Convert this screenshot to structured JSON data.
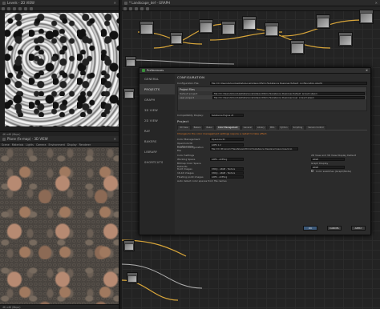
{
  "left_top_panel": {
    "title": "Levels - 2D VIEW",
    "status": "4K x4K (8bpc)"
  },
  "left_bottom_panel": {
    "title": "Plane (fx-map) - 3D VIEW",
    "menu": [
      "Scene",
      "Materials",
      "Lights",
      "Camera",
      "Environment",
      "Display",
      "Renderer"
    ],
    "status": "4K x4K (8bpc)"
  },
  "graph_panel": {
    "title": "* Landscape_def - GRAPH"
  },
  "dialog": {
    "title": "Preferences",
    "nav": [
      "GENERAL",
      "PROJECTS",
      "GRAPH",
      "3D VIEW",
      "2D VIEW",
      "RAY",
      "BAKERS",
      "LIBRARY",
      "SHORTCUTS"
    ],
    "active_nav": "PROJECTS",
    "config_heading": "CONFIGURATION",
    "config_file_label": "Configuration File:",
    "config_file_value": "file:///C:/Users/lutug/AppData/Local/Allegorithmic/Substance Designer/default_configuration.sbscfg",
    "project_files_heading": "Project Files",
    "default_project_label": "Default project",
    "default_project_value": "file:///C:/Users/lutug/AppData/Local/Allegorithmic/Substance Designer/default_project.sbsprj",
    "user_project_label": "user project",
    "user_project_value": "file:///C:/Users/lutug/AppData/Local/Allegorithmic/Substance Designer/user_project.sbsprj",
    "compat_label": "Compatibility Display:",
    "compat_value": "Substance Engine v5",
    "project_heading": "Project",
    "tabs": [
      "3D View",
      "Bakers",
      "Baker",
      "Color Management",
      "General",
      "Library",
      "MDL",
      "Python",
      "Scripting",
      "Version Control"
    ],
    "active_tab": "Color Management",
    "note": "Changes to the color management settings require a restart to take effect.",
    "color_mgmt_label": "Color Management",
    "color_mgmt_value": "OpenColorIO",
    "ocio_config_label": "OpenColorIO Configuration",
    "ocio_config_value": "ACES 1.2",
    "custom_config_label": "Custom Configuration File",
    "custom_config_value": "file:///C:/Program Files/Allegorithmic/Substance Designer/resources/ocio",
    "color_settings_heading": "Color Settings",
    "working_space_label": "Working Space",
    "working_space_value": "ACES - ACEScg",
    "bitmap_defaults_heading": "Bitmap Color Space Defaults",
    "bit8_label": "8-bit images",
    "bit8_value": "Utility - sRGB - Texture",
    "bit16_label": "16-bit images",
    "bit16_value": "Utility - sRGB - Texture",
    "float_label": "Floating point images",
    "float_value": "ACES - ACEScg",
    "auto_detect_label": "Auto detect color spaces from file names",
    "view_display_heading": "2D View and 3D View Display Default",
    "view_display_value": "sRGB",
    "graph_display_heading": "Graph Display",
    "graph_display_value": "sRGB",
    "color_swatches_label": "Color swatches (Graph/Node)",
    "ok": "OK",
    "cancel": "CANCEL",
    "apply": "APPLY"
  },
  "colors": {
    "accent_orange": "#e07b2a",
    "selected_blue": "#3d5a7a"
  }
}
